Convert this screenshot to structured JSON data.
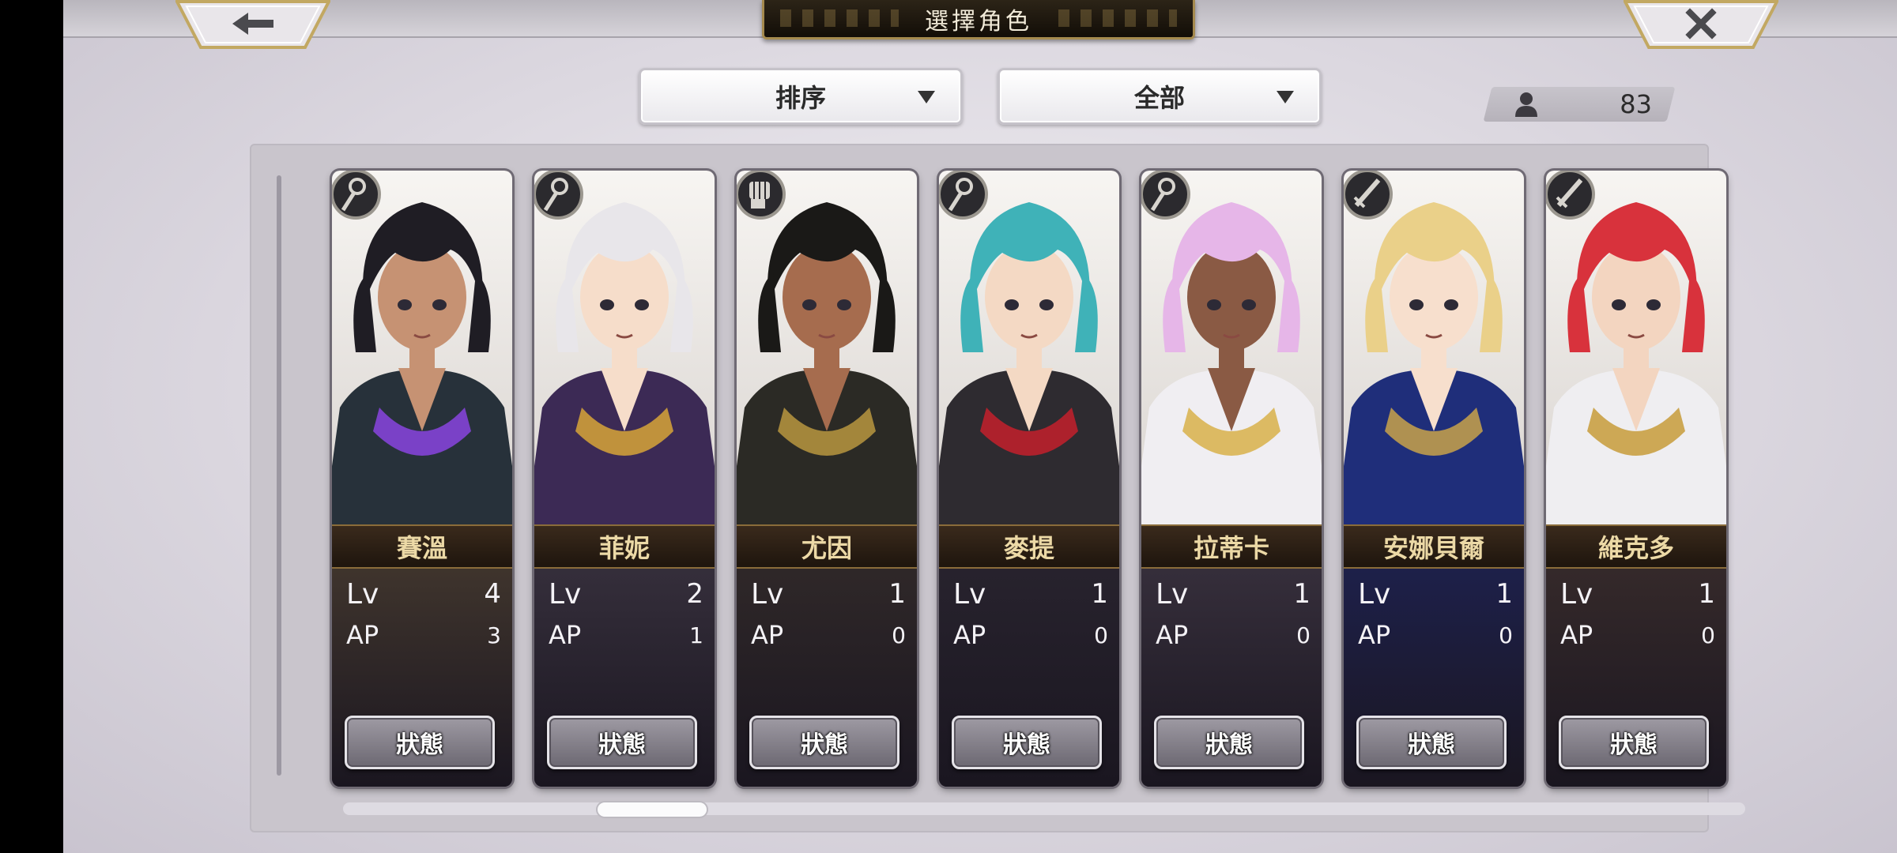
{
  "header": {
    "title": "選擇角色",
    "back_icon": "back-arrow-icon",
    "close_icon": "close-x-icon"
  },
  "filters": {
    "sort_label": "排序",
    "filter_label": "全部"
  },
  "roster": {
    "count": "83",
    "icon": "person-icon"
  },
  "labels": {
    "lv": "Lv",
    "ap": "AP",
    "status_button": "狀態"
  },
  "characters": [
    {
      "name": "賽溫",
      "lv": "4",
      "ap": "3",
      "class_icon": "staff-icon",
      "hair": "#1f1d24",
      "skin": "#c69273",
      "outfit": "#27313a",
      "accent": "#8a44e0",
      "lower": "#463a2f"
    },
    {
      "name": "菲妮",
      "lv": "2",
      "ap": "1",
      "class_icon": "staff-icon",
      "hair": "#e8e6ea",
      "skin": "#f6ddca",
      "outfit": "#3c2a55",
      "accent": "#d7a438",
      "lower": "#3a3340"
    },
    {
      "name": "尤因",
      "lv": "1",
      "ap": "0",
      "class_icon": "fist-icon",
      "hair": "#1a1917",
      "skin": "#a66c4e",
      "outfit": "#2b2a25",
      "accent": "#b89640",
      "lower": "#332b2a"
    },
    {
      "name": "麥提",
      "lv": "1",
      "ap": "0",
      "class_icon": "staff-icon",
      "hair": "#3fb2b8",
      "skin": "#f4d9c4",
      "outfit": "#2e2b30",
      "accent": "#c3202c",
      "lower": "#2a2530"
    },
    {
      "name": "拉蒂卡",
      "lv": "1",
      "ap": "0",
      "class_icon": "staff-icon",
      "hair": "#e6b6e8",
      "skin": "#8a5a44",
      "outfit": "#f0eef2",
      "accent": "#d8b04a",
      "lower": "#3b3340"
    },
    {
      "name": "安娜貝爾",
      "lv": "1",
      "ap": "0",
      "class_icon": "sword-icon",
      "hair": "#ead089",
      "skin": "#f7dfcd",
      "outfit": "#1f2e7a",
      "accent": "#c9a24a",
      "lower": "#1e2252"
    },
    {
      "name": "維克多",
      "lv": "1",
      "ap": "0",
      "class_icon": "sword-icon",
      "hair": "#d8323c",
      "skin": "#f3d5c0",
      "outfit": "#efeef1",
      "accent": "#c79b3a",
      "lower": "#3a2d2c"
    }
  ]
}
